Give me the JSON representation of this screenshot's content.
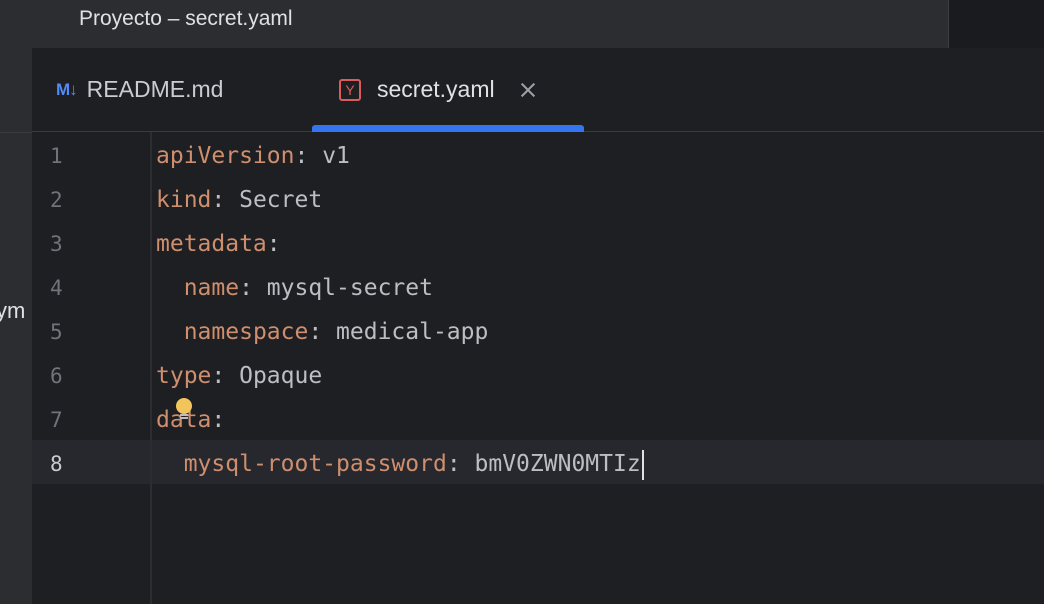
{
  "window": {
    "title": "Proyecto – secret.yaml"
  },
  "project_strip": {
    "label": "ym"
  },
  "tabs": [
    {
      "icon": "M↓",
      "label": "README.md",
      "active": false
    },
    {
      "icon": "Y",
      "label": "secret.yaml",
      "active": true
    }
  ],
  "editor": {
    "active_line": 8,
    "lines": [
      {
        "num": "1",
        "key": "apiVersion",
        "sep": ": ",
        "value": "v1",
        "indent": ""
      },
      {
        "num": "2",
        "key": "kind",
        "sep": ": ",
        "value": "Secret",
        "indent": ""
      },
      {
        "num": "3",
        "key": "metadata",
        "sep": ":",
        "value": "",
        "indent": ""
      },
      {
        "num": "4",
        "key": "name",
        "sep": ": ",
        "value": "mysql-secret",
        "indent": "  "
      },
      {
        "num": "5",
        "key": "namespace",
        "sep": ": ",
        "value": "medical-app",
        "indent": "  "
      },
      {
        "num": "6",
        "key": "type",
        "sep": ": ",
        "value": "Opaque",
        "indent": ""
      },
      {
        "num": "7",
        "key": "data",
        "sep": ":",
        "value": "",
        "indent": ""
      },
      {
        "num": "8",
        "key": "mysql-root-password",
        "sep": ": ",
        "value": "bmV0ZWN0MTIz",
        "indent": "  "
      }
    ]
  },
  "colors": {
    "key": "#cf8e6d",
    "value": "#bcbec4",
    "accent": "#3574f0",
    "bulb": "#f2c55c"
  }
}
